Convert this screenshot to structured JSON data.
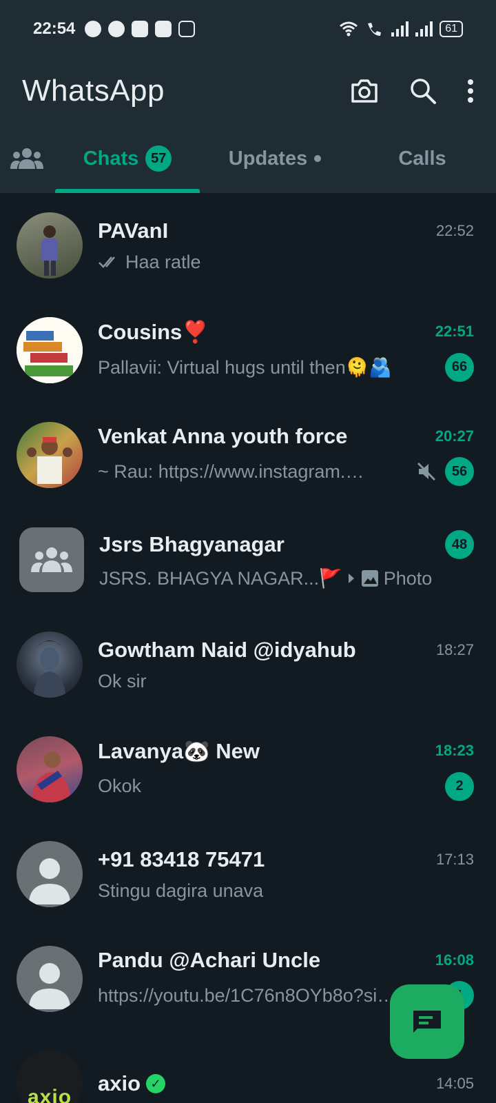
{
  "status_bar": {
    "time": "22:54",
    "battery": "61"
  },
  "header": {
    "title": "WhatsApp"
  },
  "tabs": {
    "chats_label": "Chats",
    "chats_count": "57",
    "updates_label": "Updates",
    "calls_label": "Calls"
  },
  "chats": [
    {
      "name": "PAVanI",
      "time": "22:52",
      "preview": "Haa ratle"
    },
    {
      "name": "Cousins❣️",
      "time": "22:51",
      "preview": "Pallavii: Virtual hugs until then🫠🫂",
      "unread": "66"
    },
    {
      "name": "Venkat Anna youth force",
      "time": "20:27",
      "preview": "~ Rau: https://www.instagram.…",
      "unread": "56"
    },
    {
      "name": "Jsrs Bhagyanagar",
      "preview": "JSRS. BHAGYA NAGAR...🚩",
      "preview_media": "Photo",
      "unread": "48"
    },
    {
      "name": "Gowtham Naid @idyahub",
      "time": "18:27",
      "preview": "Ok sir"
    },
    {
      "name": "Lavanya🐼 New",
      "time": "18:23",
      "preview": "Okok",
      "unread": "2"
    },
    {
      "name": "+91 83418 75471",
      "time": "17:13",
      "preview": "Stingu dagira unava"
    },
    {
      "name": "Pandu @Achari Uncle",
      "time": "16:08",
      "preview": "https://youtu.be/1C76n8OYb8o?si…",
      "unread": "1"
    },
    {
      "name": "axio",
      "time": "14:05"
    }
  ],
  "axio_logo_text": "axio",
  "colors": {
    "accent": "#00a884",
    "background": "#111b21",
    "header": "#202c33"
  }
}
